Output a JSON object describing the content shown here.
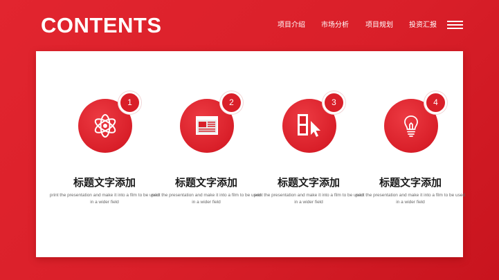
{
  "header": {
    "title": "CONTENTS",
    "nav": [
      {
        "label": "项目介绍"
      },
      {
        "label": "市场分析"
      },
      {
        "label": "项目规划"
      },
      {
        "label": "投资汇报"
      }
    ]
  },
  "cards": [
    {
      "number": "1",
      "icon": "atom-icon",
      "title": "标题文字添加",
      "desc": "print the presentation and make it into a film to be used in a wider field"
    },
    {
      "number": "2",
      "icon": "browser-window-icon",
      "title": "标题文字添加",
      "desc": "print the presentation and make it into a film to be used in a wider field"
    },
    {
      "number": "3",
      "icon": "film-cursor-icon",
      "title": "标题文字添加",
      "desc": "print the presentation and make it into a film to be used in a wider field"
    },
    {
      "number": "4",
      "icon": "lightbulb-icon",
      "title": "标题文字添加",
      "desc": "print the presentation and make it into a film to be used in a wider field"
    }
  ],
  "colors": {
    "accent": "#d91f29",
    "background": "#d91f29",
    "panel": "#ffffff",
    "title_text": "#1a1a1a",
    "desc_text": "#666666"
  }
}
